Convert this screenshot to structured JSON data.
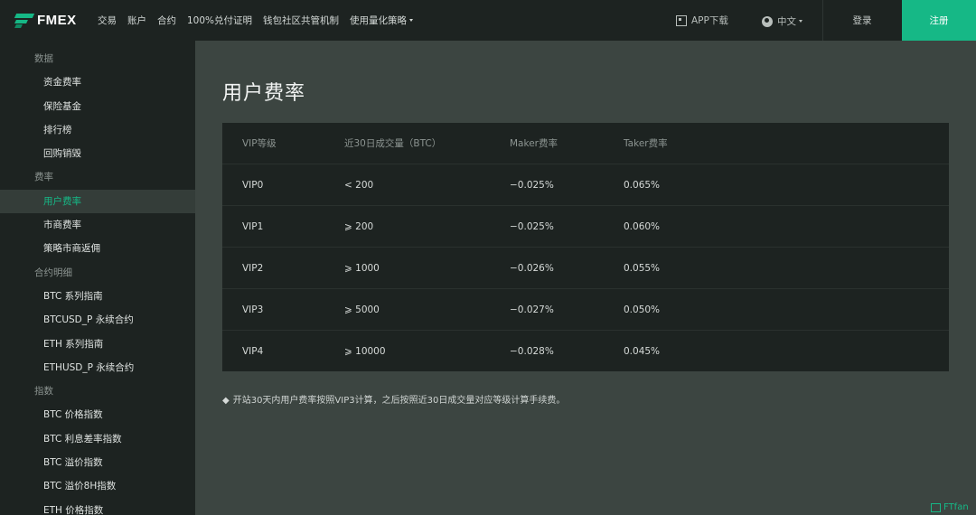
{
  "header": {
    "logo_text": "FMEX",
    "nav": [
      {
        "label": "交易"
      },
      {
        "label": "账户"
      },
      {
        "label": "合约"
      },
      {
        "label": "100%兑付证明"
      },
      {
        "label": "钱包社区共管机制"
      },
      {
        "label": "使用量化策略"
      }
    ],
    "app_download": "APP下载",
    "language": "中文",
    "login": "登录",
    "register": "注册"
  },
  "sidebar": {
    "groups": [
      {
        "title": "数据",
        "items": [
          "资金费率",
          "保险基金",
          "排行榜",
          "回购销毁"
        ]
      },
      {
        "title": "费率",
        "items": [
          "用户费率",
          "市商费率",
          "策略市商返佣"
        ]
      },
      {
        "title": "合约明细",
        "items": [
          "BTC 系列指南",
          "BTCUSD_P 永续合约",
          "ETH 系列指南",
          "ETHUSD_P 永续合约"
        ]
      },
      {
        "title": "指数",
        "items": [
          "BTC 价格指数",
          "BTC 利息差率指数",
          "BTC 溢价指数",
          "BTC 溢价8H指数",
          "ETH 价格指数"
        ]
      }
    ],
    "active_item": "用户费率"
  },
  "main": {
    "title": "用户费率",
    "table": {
      "headers": [
        "VIP等级",
        "近30日成交量（BTC）",
        "Maker费率",
        "Taker费率"
      ],
      "rows": [
        [
          "VIP0",
          "< 200",
          "−0.025%",
          "0.065%"
        ],
        [
          "VIP1",
          "⩾ 200",
          "−0.025%",
          "0.060%"
        ],
        [
          "VIP2",
          "⩾ 1000",
          "−0.026%",
          "0.055%"
        ],
        [
          "VIP3",
          "⩾ 5000",
          "−0.027%",
          "0.050%"
        ],
        [
          "VIP4",
          "⩾ 10000",
          "−0.028%",
          "0.045%"
        ]
      ]
    },
    "note_bullet": "◆",
    "note": "开站30天内用户费率按照VIP3计算，之后按照近30日成交量对应等级计算手续费。"
  },
  "watermark": "FTfan"
}
